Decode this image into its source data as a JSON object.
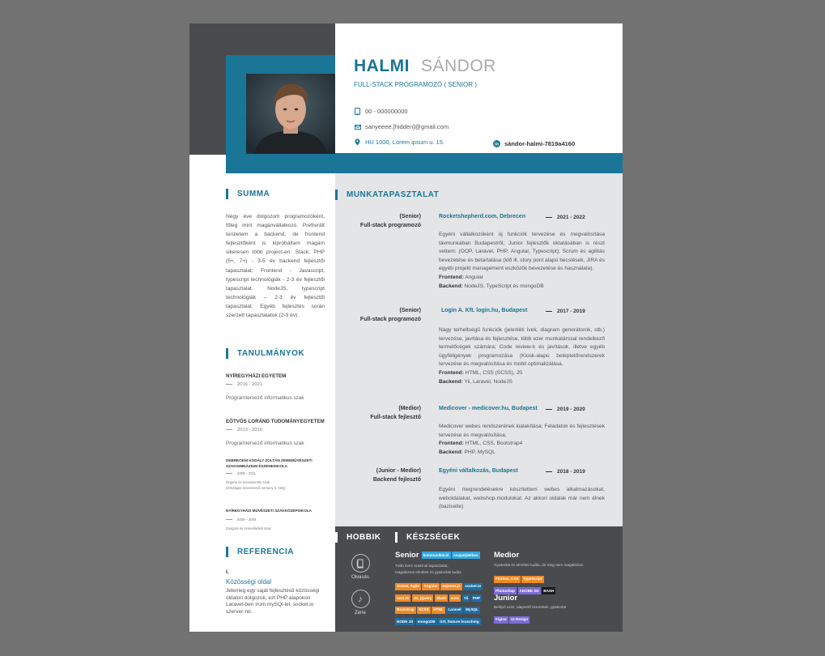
{
  "header": {
    "first_name": "HALMI",
    "last_name": "SÁNDOR",
    "title": "FULL-STACK PROGRAMOZÓ ( SENIOR )",
    "phone": "00 - 000000000",
    "email": "sanyeeee.[hidden]@gmail.com",
    "address": "HU 1000, Lorem ipsum u. 15.",
    "linkedin": "sándor-halmi-7819a4160"
  },
  "summary": {
    "title": "SUMMA",
    "text": "Négy éve dolgozom programozóként, főleg mint magánvállalkozó. Prefrerált területem a backend, de frontend fejlesztőként is kipróbáltam magam sikeresen több project-en. Stack: PHP (5+, 7+) - 3-5 év backend fejlesztői tapasztalat; Frontend - Javascript, typescript technológiák - 2-3 év fejlesztői tapasztalat. NodeJS, typescript technológiák – 2-3 év fejlesztői tapasztalat. Egyéb fejlesztés során szerzett tapasztalatok (2-3 év)."
  },
  "education": {
    "title": "TANULMÁNYOK",
    "items": [
      {
        "name": "NYÍREGYHÁZI EGYETEM",
        "date": "2016 - 2021",
        "desc": "Programtervező informatikus szak"
      },
      {
        "name": "EÖTVÖS LORÁND TUDOMÁNYEGYETEM",
        "date": "2013 - 2016",
        "desc": "Programtervező informatikus szak"
      }
    ],
    "small_items": [
      {
        "name_line1": "DEBRECENI KODÁLY ZOLTÁN ZENEMŰVÉSZETI",
        "name_line2": "SZAKGIMNÁZIUM ÉSZENEISKOLA",
        "date": "2009 – 2011",
        "desc_line1": "Orgona és zeneszerzés szak",
        "desc_line2": "(Országos zeneszerzői verseny 3. hely)"
      },
      {
        "name_line1": "NYÍREGYHÁZI MŰVÉSZETI SZAKKÖZÉPISKOLA",
        "name_line2": "",
        "date": "2009 – 2009",
        "desc_line1": "Zongora és zeneelméleti szak",
        "desc_line2": ""
      }
    ]
  },
  "reference": {
    "title": "REFERENCIA",
    "number": "I.",
    "link": "Közösségi oldal",
    "text": "Jelenleg egy saját fejlesztésű közösségi oldalon dolgozok, ezt PHP alapokon Laravel-ben írom mySQl-lel, socket.io szerver-rel."
  },
  "experience": {
    "title": "MUNKATAPASZTALAT",
    "jobs": [
      {
        "level": "(Senior)",
        "role": "Full-stack programozó",
        "company": "Rocketshepherd.com, Debrecen",
        "date": "2021 - 2022",
        "desc": "Egyéni vállalkozóként új funkciók tervezése és megvalósítása távmunkában Budapestről; Junior fejlesztők oktatásában is részt vettem: (OOP, Laravel, PHP, Angular, Typescript); Scrum és agilitás bevezetése és betartatása (idő ill. story pont alapú becslések, JIRA és egyéb projekt management eszközök bevezetése és használata).",
        "frontend_label": "Frontend:",
        "frontend": "Angular",
        "backend_label": "Backend:",
        "backend": "NodeJS, TypeScript és mongoDB"
      },
      {
        "level": "(Senior)",
        "role": "Full-stack programozó",
        "company": "Login A. Kft. login.hu, Budapest",
        "date": "2017 - 2019",
        "desc": "Nagy terheltségű funkciók (jelenléti ívek, diagram generátorok, stb.) tervezése, javítása és fejlesztése, több ezer munkatárssal rendelkező termelőcégek számára; Code review-k és javítások, illetve egyéb ügyféligények programozása (Kiosk-alapú beléptetőrendszerek tervezése és megvalósítása és mobil optimalizálása.",
        "frontend_label": "Frontend:",
        "frontend": "HTML, CSS (SCSS), JS",
        "backend_label": "Backend:",
        "backend": "Yii, Laravel, NodeJS"
      },
      {
        "level": "(Medior)",
        "role": "Full-stack fejlesztő",
        "company": "Medicover - medicover.hu, Budapest",
        "date": "2019 - 2020",
        "desc": "Medicover webes rendszerének kialakítása; Feladatok és fejlesztések tervezése és megvalósítása;",
        "frontend_label": "Frontend:",
        "frontend": "HTML, CSS, Bootstrap4",
        "backend_label": "Backend:",
        "backend": "PHP, MySQL"
      },
      {
        "level": "(Junior - Medior)",
        "role": "Backend fejlesztő",
        "company": "Egyéni vállalkozás, Budapest",
        "date": "2018 - 2019",
        "desc": "Egyéni megrendelésekre készítettem webes alkalmazásokat, weboldalakat, webshop-modulokat. Az akkori oldalak már nem élnek (baziselte)",
        "frontend_label": "",
        "frontend": "",
        "backend_label": "",
        "backend": ""
      }
    ]
  },
  "hobbies": {
    "title": "HOBBIK",
    "items": [
      {
        "label": "Olvasás",
        "icon": "book-icon"
      },
      {
        "label": "Zene",
        "icon": "music-note-icon"
      }
    ]
  },
  "skills": {
    "title": "KÉSZSÉGEK",
    "senior": {
      "label": "Senior",
      "soft_tags": [
        "kommunikáció",
        "csapatjátékos"
      ],
      "desc_line1": "Több éves szakmai tapasztalat,",
      "desc_line2": "magabiztos elméleti és gyakorlati tudás",
      "tags": [
        {
          "t": "Scrum, Agile",
          "c": "orange"
        },
        {
          "t": "Angular",
          "c": "orange"
        },
        {
          "t": "express.js",
          "c": "orange"
        },
        {
          "t": "socket.io",
          "c": "navy"
        },
        {
          "t": "nextJS",
          "c": "orange"
        },
        {
          "t": "JS, jQuery",
          "c": "orange"
        },
        {
          "t": "Slade",
          "c": "orange"
        },
        {
          "t": "Ionic",
          "c": "orange"
        },
        {
          "t": "Yii",
          "c": "navy"
        },
        {
          "t": "PHP",
          "c": "navy"
        },
        {
          "t": "Bootstrap",
          "c": "orange"
        },
        {
          "t": "SCSS",
          "c": "orange"
        },
        {
          "t": "HTML",
          "c": "orange"
        },
        {
          "t": "Laravel",
          "c": "navy"
        },
        {
          "t": "MySQL",
          "c": "navy"
        },
        {
          "t": "NODE JS",
          "c": "navy"
        },
        {
          "t": "mongoDB",
          "c": "navy"
        },
        {
          "t": "GIT, feature branching",
          "c": "navy"
        }
      ]
    },
    "medior": {
      "label": "Medior",
      "desc": "Gyakorlat és elméleti tudás, de még nem magabiztos",
      "tags": [
        {
          "t": "Firebox, CSS",
          "c": "orange"
        },
        {
          "t": "TypeScript",
          "c": "orange"
        },
        {
          "t": "Photoshop",
          "c": "purple"
        },
        {
          "t": "ADOBE XD",
          "c": "purple"
        },
        {
          "t": "BASH",
          "c": "black"
        }
      ]
    },
    "junior": {
      "label": "Junior",
      "desc": "Belépő szint, alapvető ismeretek, gyakorlat",
      "tags": [
        {
          "t": "Figma",
          "c": "purple"
        },
        {
          "t": "UI Design",
          "c": "purple"
        }
      ]
    }
  },
  "colors": {
    "accent": "#1a7596",
    "dark": "#4a4b4e",
    "gray": "#e4e5e7"
  }
}
